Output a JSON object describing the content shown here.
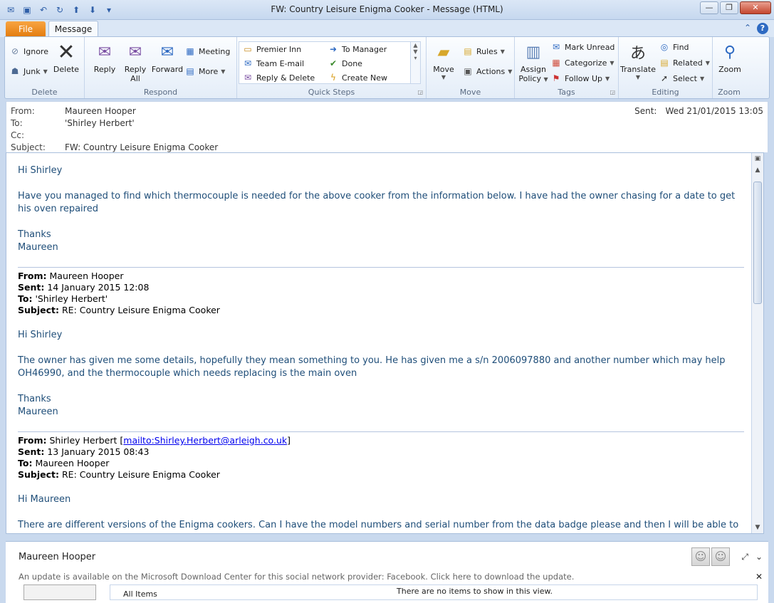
{
  "window": {
    "title": "FW: Country Leisure Enigma Cooker  -  Message (HTML)",
    "controls": {
      "minimize": "—",
      "restore": "❐",
      "close": "✕"
    }
  },
  "qat": [
    {
      "name": "mail-icon",
      "glyph": "✉"
    },
    {
      "name": "save-icon",
      "glyph": "▣"
    },
    {
      "name": "undo-icon",
      "glyph": "↶"
    },
    {
      "name": "redo-icon",
      "glyph": "↻"
    },
    {
      "name": "up-icon",
      "glyph": "⬆"
    },
    {
      "name": "down-icon",
      "glyph": "⬇"
    },
    {
      "name": "customize-icon",
      "glyph": "▾"
    }
  ],
  "tabs": {
    "file": "File",
    "message": "Message"
  },
  "ribbon": {
    "delete": {
      "label": "Delete",
      "ignore": "Ignore",
      "junk": "Junk",
      "delete": "Delete"
    },
    "respond": {
      "label": "Respond",
      "reply": "Reply",
      "reply_all_1": "Reply",
      "reply_all_2": "All",
      "forward": "Forward",
      "meeting": "Meeting",
      "more": "More"
    },
    "quick_steps": {
      "label": "Quick Steps",
      "items": [
        "Premier Inn",
        "To Manager",
        "Team E-mail",
        "Done",
        "Reply & Delete",
        "Create New"
      ]
    },
    "move": {
      "label": "Move",
      "move": "Move",
      "rules": "Rules",
      "actions": "Actions"
    },
    "tags": {
      "label": "Tags",
      "assign_1": "Assign",
      "assign_2": "Policy",
      "mark_unread": "Mark Unread",
      "categorize": "Categorize",
      "follow_up": "Follow Up"
    },
    "editing": {
      "label": "Editing",
      "translate": "Translate",
      "find": "Find",
      "related": "Related",
      "select": "Select"
    },
    "zoom": {
      "label": "Zoom",
      "zoom": "Zoom"
    }
  },
  "header": {
    "from_label": "From:",
    "from": "Maureen Hooper",
    "to_label": "To:",
    "to": "'Shirley Herbert'",
    "cc_label": "Cc:",
    "cc": "",
    "subject_label": "Subject:",
    "subject": "FW: Country Leisure Enigma Cooker",
    "sent_label": "Sent:",
    "sent": "Wed 21/01/2015 13:05"
  },
  "body": {
    "m1_greeting": "Hi Shirley",
    "m1_text": "Have you managed to find which thermocouple is needed for the above cooker from the information below.  I have had the owner chasing for a date to get his oven repaired",
    "m1_thanks": "Thanks",
    "m1_name": "Maureen",
    "f1": {
      "from_label": "From:",
      "from": "Maureen Hooper",
      "sent_label": "Sent:",
      "sent": "14 January 2015 12:08",
      "to_label": "To:",
      "to": "'Shirley Herbert'",
      "subject_label": "Subject:",
      "subject": "RE: Country Leisure Enigma Cooker"
    },
    "m2_greeting": "Hi Shirley",
    "m2_text": "The owner has given me some details, hopefully they mean something to you.  He has given me a s/n 2006097880  and another number which  may help OH46990, and the thermocouple which needs replacing is the main oven",
    "m2_thanks": "Thanks",
    "m2_name": "Maureen",
    "f2": {
      "from_label": "From:",
      "from": "Shirley Herbert",
      "mailto": "mailto:Shirley.Herbert@arleigh.co.uk",
      "sent_label": "Sent:",
      "sent": "13 January 2015 08:43",
      "to_label": "To:",
      "to": "Maureen Hooper",
      "subject_label": "Subject:",
      "subject": "RE: Country Leisure Enigma Cooker"
    },
    "m3_greeting": "Hi Maureen",
    "m3_text": "There are different versions of the Enigma cookers.  Can I have the model numbers and serial number from the data badge please and then I will be able to work this"
  },
  "people_pane": {
    "name": "Maureen Hooper",
    "update": "An update is available on the Microsoft Download Center for this social network provider: Facebook. Click here to download the update.",
    "all_items": "All Items",
    "no_items": "There are no items to show in this view."
  }
}
